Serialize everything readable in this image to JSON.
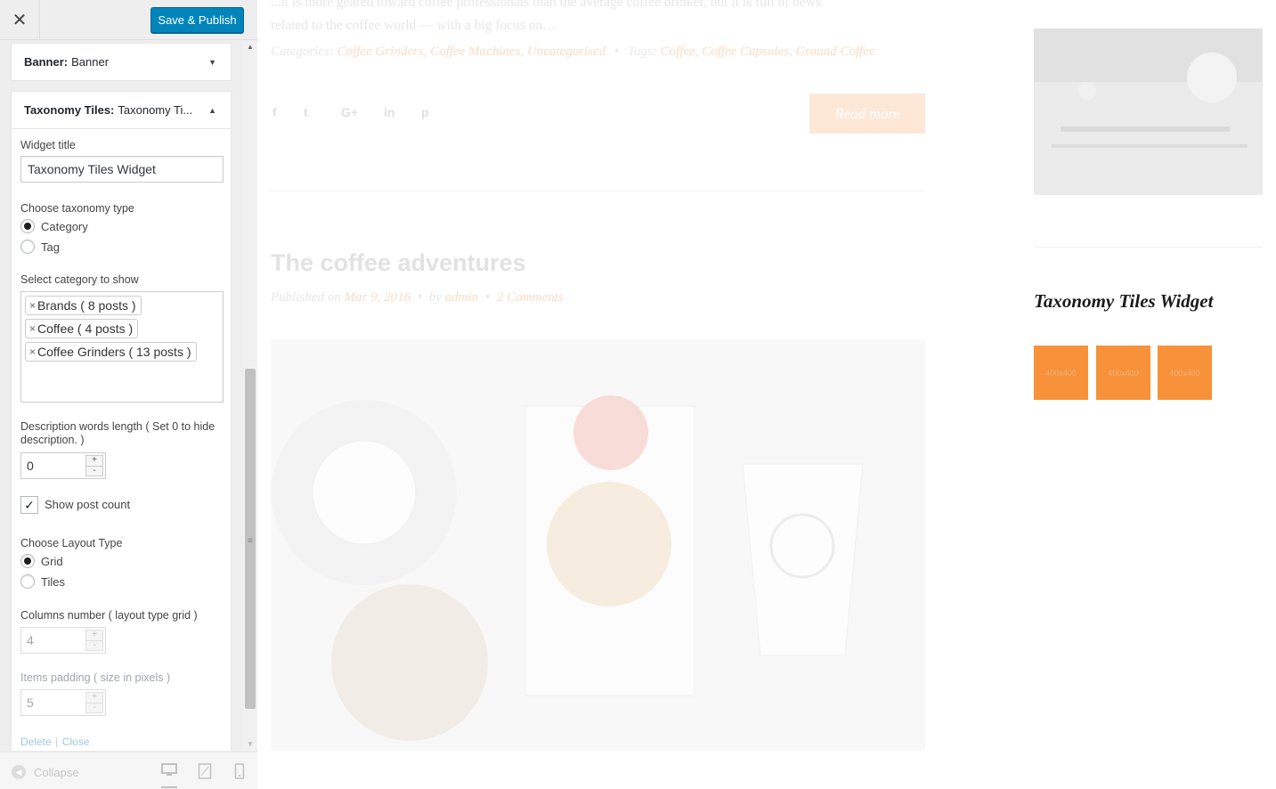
{
  "customizer": {
    "close_label": "✕",
    "publish_label": "Save & Publish",
    "banner_widget": {
      "type": "Banner:",
      "name": "Banner"
    },
    "taxonomy_widget": {
      "type": "Taxonomy Tiles:",
      "name": "Taxonomy Ti..."
    },
    "form": {
      "widget_title_label": "Widget title",
      "widget_title_value": "Taxonomy Tiles Widget",
      "taxonomy_type_label": "Choose taxonomy type",
      "taxonomy_options": [
        {
          "label": "Category",
          "selected": true
        },
        {
          "label": "Tag",
          "selected": false
        }
      ],
      "select_category_label": "Select category to show",
      "selected_categories": [
        "Brands ( 8 posts )",
        "Coffee ( 4 posts )",
        "Coffee Grinders ( 13 posts )"
      ],
      "chip_remove": "×",
      "desc_length_label": "Description words length ( Set 0 to hide description. )",
      "desc_length_value": "0",
      "show_post_count_label": "Show post count",
      "show_post_count_checked": true,
      "layout_type_label": "Choose Layout Type",
      "layout_options": [
        {
          "label": "Grid",
          "selected": true
        },
        {
          "label": "Tiles",
          "selected": false
        }
      ],
      "columns_label": "Columns number ( layout type grid )",
      "columns_value": "4",
      "padding_label": "Items padding ( size in pixels )",
      "padding_value": "5",
      "delete_label": "Delete",
      "separator": "|",
      "close_label": "Close",
      "spin_up": "+",
      "spin_down": "-"
    },
    "footer": {
      "collapse_label": "Collapse"
    }
  },
  "preview": {
    "excerpt_line1": "...it is more geared toward coffee professionals than the average coffee drinker, but it is full of news",
    "excerpt_line2": "related to the coffee world — with a big focus on…",
    "categories_label": "Categories:",
    "categories": "Coffee Grinders, Coffee Machines, Uncategorised",
    "bullet": "•",
    "tags_label": "Tags:",
    "tags": "Coffee, Coffee Capsules, Ground Coffee",
    "social_icons": [
      "f",
      "t",
      "G+",
      "in",
      "p"
    ],
    "read_more": "Read more",
    "post_title": "The coffee adventures",
    "published_on": "Published on",
    "post_date": "Mar 9, 2016",
    "by": "by",
    "author": "admin",
    "comments": "2 Comments",
    "sidebar_widget_title": "Taxonomy Tiles Widget",
    "tiles": [
      "400x400",
      "400x400",
      "400x400"
    ]
  },
  "colors": {
    "publish": "#0085ba",
    "tile": "#f7923a"
  }
}
